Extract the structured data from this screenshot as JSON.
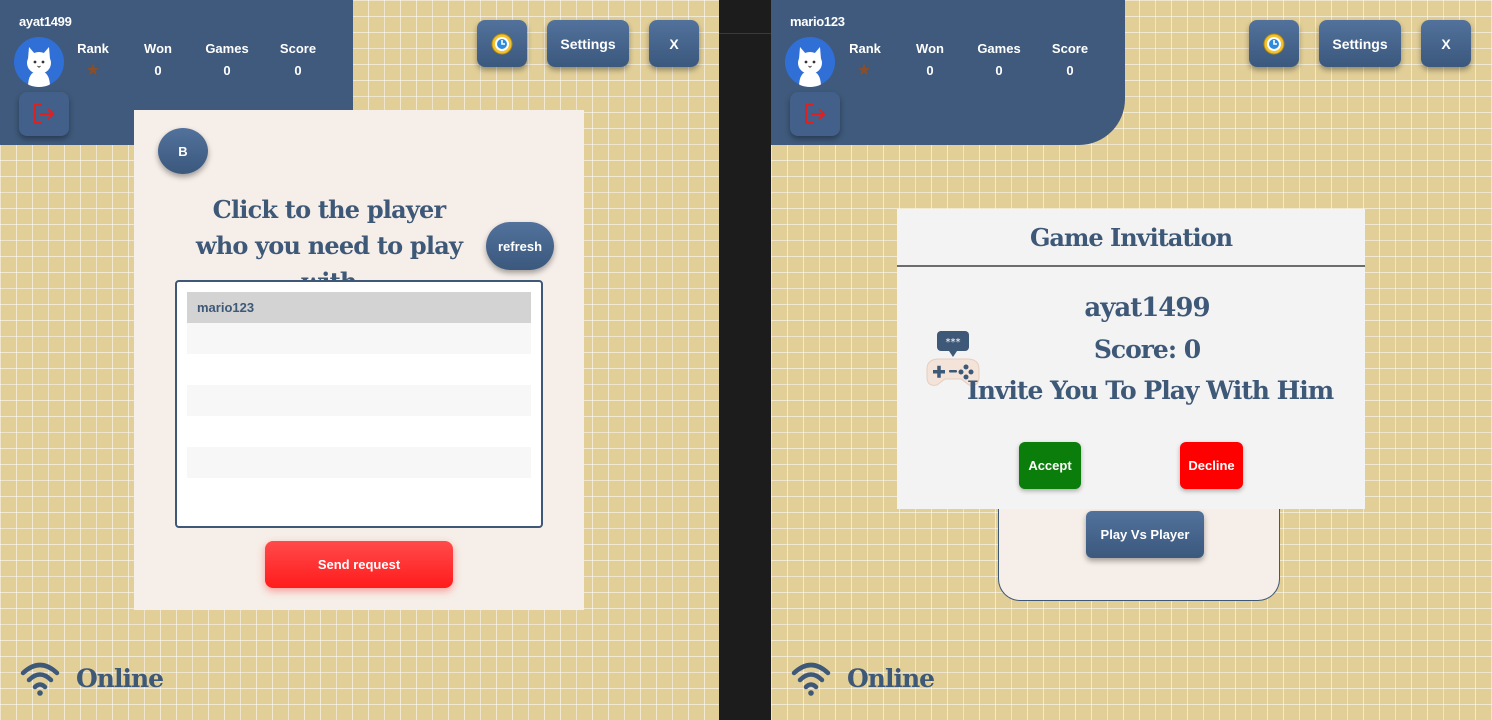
{
  "left": {
    "header": {
      "username": "ayat1499",
      "stats": [
        {
          "label": "Rank",
          "value": "★"
        },
        {
          "label": "Won",
          "value": "0"
        },
        {
          "label": "Games",
          "value": "0"
        },
        {
          "label": "Score",
          "value": "0"
        }
      ],
      "settings_label": "Settings",
      "close_label": "X"
    },
    "panel": {
      "back_label": "B",
      "title": "Click to the player who you need to play with",
      "refresh_label": "refresh",
      "players": [
        "mario123",
        "",
        "",
        "",
        "",
        "",
        ""
      ],
      "send_label": "Send request"
    },
    "status": "Online"
  },
  "right": {
    "header": {
      "username": "mario123",
      "stats": [
        {
          "label": "Rank",
          "value": "★"
        },
        {
          "label": "Won",
          "value": "0"
        },
        {
          "label": "Games",
          "value": "0"
        },
        {
          "label": "Score",
          "value": "0"
        }
      ],
      "settings_label": "Settings",
      "close_label": "X"
    },
    "modal": {
      "title": "Game Invitation",
      "player": "ayat1499",
      "score": "Score: 0",
      "message": "Invite You To Play With Him",
      "accept_label": "Accept",
      "decline_label": "Decline"
    },
    "pvp_label": "Play Vs Player",
    "status": "Online"
  },
  "colors": {
    "primary": "#3f5a7c",
    "background": "#e2cf98",
    "accept": "#0a7d0a",
    "decline": "#ff0000",
    "send": "#ff2a2a"
  }
}
